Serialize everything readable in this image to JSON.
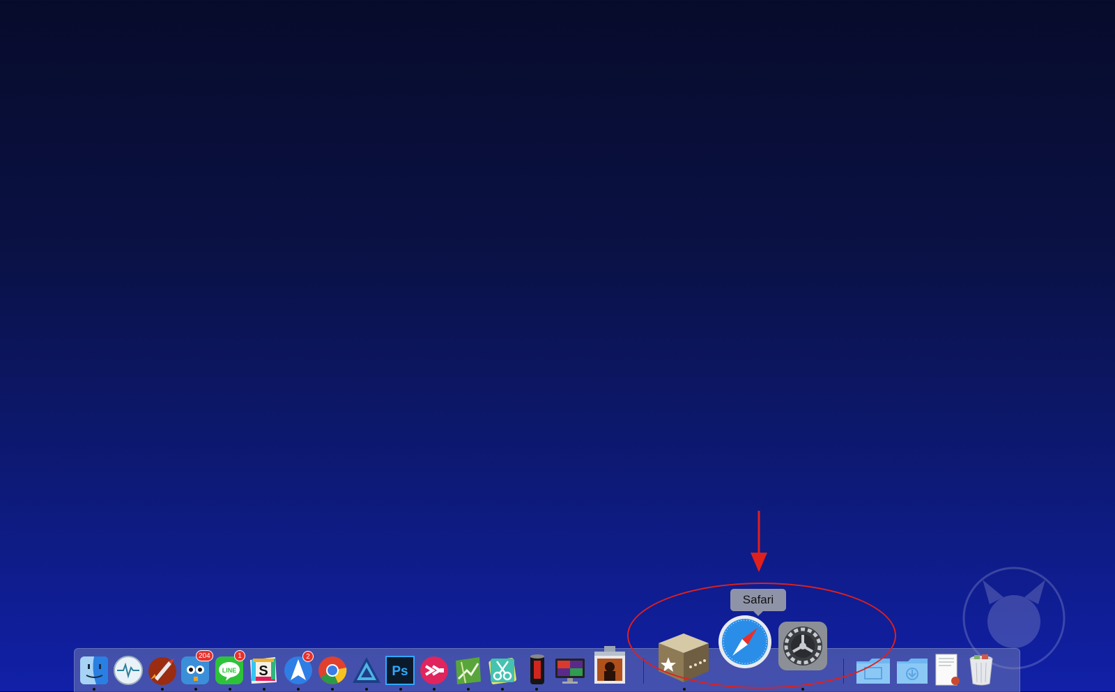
{
  "desktop": {
    "background": "dark blue gradient"
  },
  "tooltip": {
    "label": "Safari"
  },
  "dock": {
    "items": [
      {
        "name": "Finder",
        "icon": "finder-icon",
        "running": true
      },
      {
        "name": "Activity Monitor",
        "icon": "pulse-icon",
        "running": false
      },
      {
        "name": "Rocket",
        "icon": "rocket-icon",
        "running": true
      },
      {
        "name": "Tweetbot",
        "icon": "bird-icon",
        "running": true,
        "badge": "204"
      },
      {
        "name": "LINE",
        "icon": "line-icon",
        "running": true,
        "badge": "1",
        "icon_text": "LINE"
      },
      {
        "name": "Slack",
        "icon": "slack-icon",
        "running": true,
        "icon_text": "S"
      },
      {
        "name": "Spark",
        "icon": "paper-plane-icon",
        "running": true,
        "badge": "2"
      },
      {
        "name": "Google Chrome",
        "icon": "chrome-icon",
        "running": true
      },
      {
        "name": "Affinity Designer",
        "icon": "affinity-icon",
        "running": true
      },
      {
        "name": "Photoshop",
        "icon": "photoshop-icon",
        "running": true,
        "icon_text": "Ps"
      },
      {
        "name": "Skitch",
        "icon": "skitch-icon",
        "running": true
      },
      {
        "name": "Maps",
        "icon": "map-icon",
        "running": true
      },
      {
        "name": "Scissors app",
        "icon": "scissors-icon",
        "running": true
      },
      {
        "name": "Pro",
        "icon": "can-icon",
        "running": true
      },
      {
        "name": "Display",
        "icon": "monitor-icon",
        "running": false
      },
      {
        "name": "Photo Booth",
        "icon": "photo-booth-icon",
        "running": false
      },
      {
        "name": "Reeder",
        "icon": "star-box-icon",
        "running": true
      },
      {
        "name": "Safari",
        "icon": "compass-icon",
        "running": false
      },
      {
        "name": "System Preferences",
        "icon": "gear-icon",
        "running": true
      },
      {
        "name": "Applications folder",
        "icon": "folder-icon",
        "running": false
      },
      {
        "name": "Downloads folder",
        "icon": "download-folder-icon",
        "running": false
      },
      {
        "name": "Document",
        "icon": "document-icon",
        "running": false
      },
      {
        "name": "Trash",
        "icon": "trash-icon",
        "running": false
      }
    ]
  },
  "annotation": {
    "color": "#e0201c",
    "shapes": [
      "arrow-down",
      "ellipse"
    ]
  },
  "watermark": {
    "icon": "monkey-icon"
  }
}
